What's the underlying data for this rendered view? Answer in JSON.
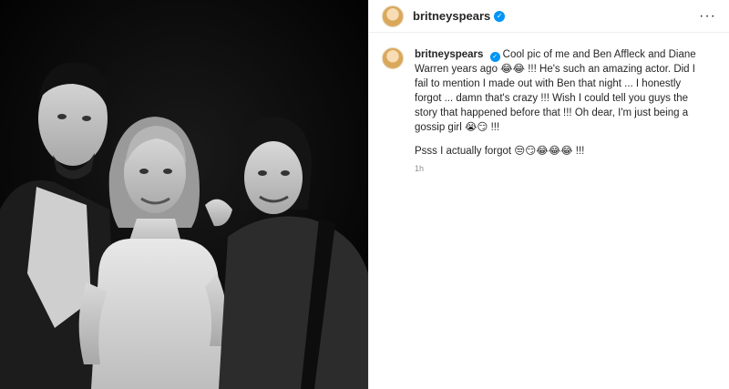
{
  "header": {
    "username": "britneyspears",
    "more_label": "···"
  },
  "caption": {
    "username": "britneyspears",
    "line1": "Cool pic of me and Ben Affleck and Diane Warren years ago 😂😂 !!! He's such an amazing actor. Did I fail to mention I made out with Ben that night ... I honestly forgot ... damn that's crazy !!! Wish I could tell you guys the story that happened before that !!! Oh dear, I'm just being a gossip girl 😭😏 !!!",
    "line2": "Psss I actually forgot 😒😏😂😂😂 !!!",
    "timestamp": "1h"
  },
  "icons": {
    "verified": "verified-badge-icon",
    "more": "more-options-icon"
  },
  "colors": {
    "verified": "#0095f6",
    "timestamp": "#8e8e8e",
    "text": "#262626"
  }
}
